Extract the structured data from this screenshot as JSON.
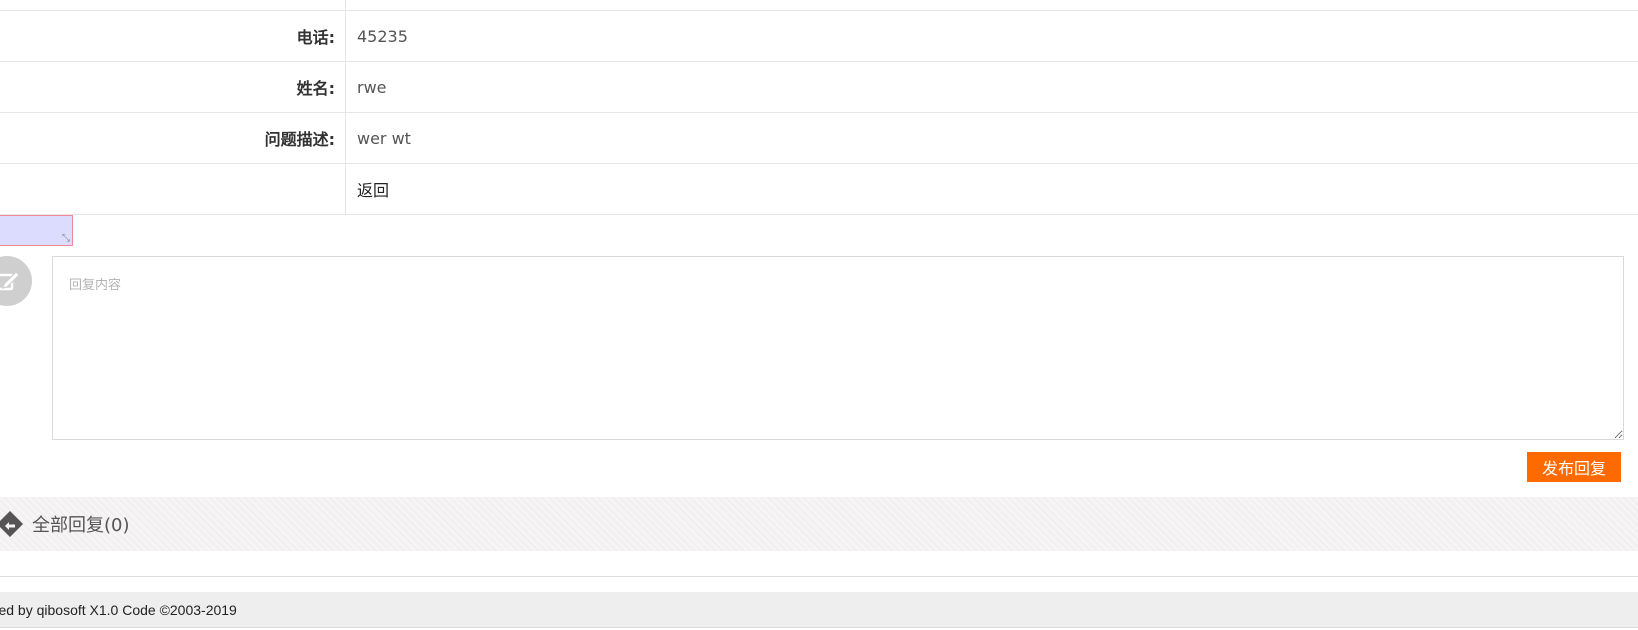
{
  "detail": {
    "phone": {
      "label": "电话:",
      "value": "45235"
    },
    "name": {
      "label": "姓名:",
      "value": "rwe"
    },
    "description": {
      "label": "问题描述:",
      "value": "wer wt"
    },
    "back_label": "返回"
  },
  "reply": {
    "placeholder": "回复内容",
    "publish_label": "发布回复"
  },
  "replies": {
    "title": "全部回复(0)"
  },
  "footer": {
    "prefix": "ered by ",
    "brand": "qibosoft",
    "suffix": " X1.0 Code ©2003-2019"
  },
  "colors": {
    "accent": "#ff6a00",
    "footer_bg": "#eeeeee",
    "replies_bar_bg": "#f6f4f4"
  },
  "icons": {
    "avatar": "edit-pencil-icon",
    "replies": "diamond-arrow-icon",
    "resize": "resize-grip-icon"
  }
}
